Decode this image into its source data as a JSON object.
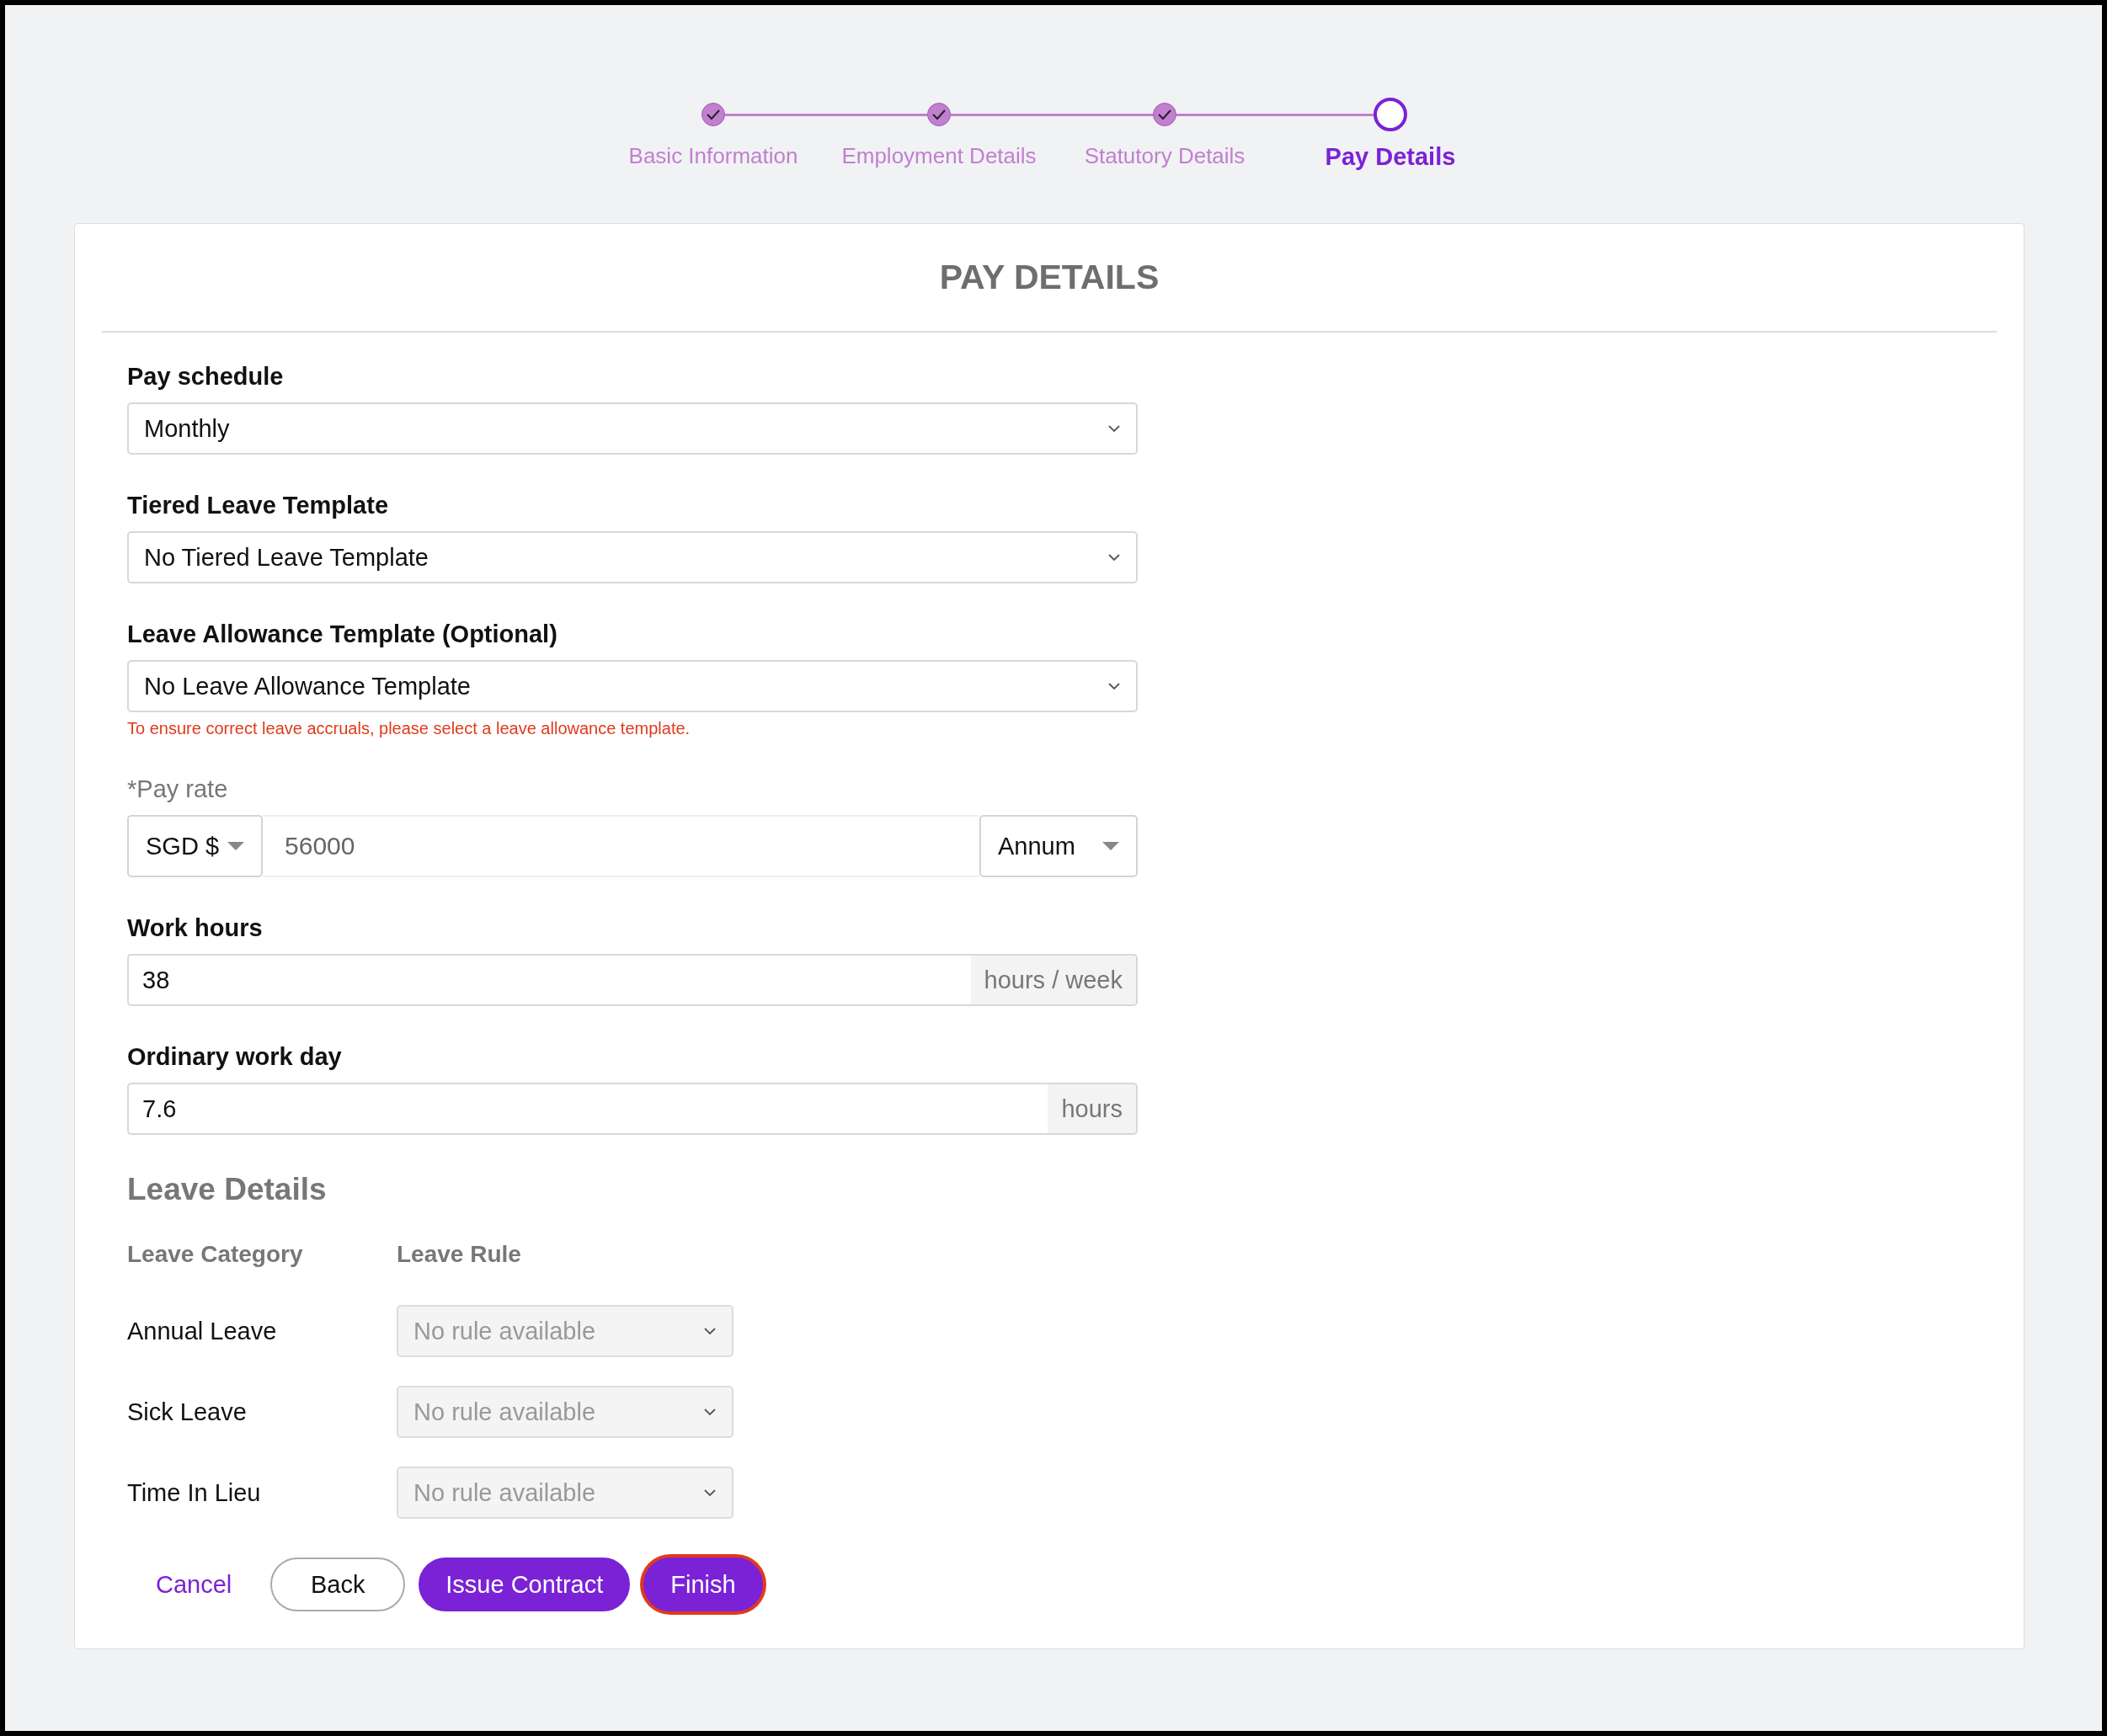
{
  "steps": [
    {
      "label": "Basic Information",
      "done": true,
      "selected": false
    },
    {
      "label": "Employment Details",
      "done": true,
      "selected": false
    },
    {
      "label": "Statutory Details",
      "done": true,
      "selected": false
    },
    {
      "label": "Pay Details",
      "done": false,
      "selected": true
    }
  ],
  "title": "PAY DETAILS",
  "selects": [
    {
      "label": "Pay schedule",
      "value": "Monthly"
    },
    {
      "label": "Tiered Leave Template",
      "value": "No Tiered Leave Template"
    },
    {
      "label": "Leave Allowance Template (Optional)",
      "value": "No Leave Allowance Template",
      "error": "To ensure correct leave accruals, please select a leave allowance template."
    }
  ],
  "pay_rate": {
    "label": "*Pay rate",
    "currency": "SGD $",
    "value": "56000",
    "period": "Annum"
  },
  "addon_fields": [
    {
      "label": "Work hours",
      "value": "38",
      "unit": "hours / week"
    },
    {
      "label": "Ordinary work day",
      "value": "7.6",
      "unit": "hours"
    }
  ],
  "leave_details": {
    "heading": "Leave Details",
    "columns": [
      "Leave Category",
      "Leave Rule"
    ],
    "rows": [
      {
        "category": "Annual Leave",
        "rule": "No rule available",
        "disabled": true
      },
      {
        "category": "Sick Leave",
        "rule": "No rule available",
        "disabled": true
      },
      {
        "category": "Time In Lieu",
        "rule": "No rule available",
        "disabled": true
      }
    ]
  },
  "buttons": [
    {
      "label": "Cancel",
      "kind": "link",
      "focused": false
    },
    {
      "label": "Back",
      "kind": "outline",
      "focused": false
    },
    {
      "label": "Issue Contract",
      "kind": "primary",
      "focused": false
    },
    {
      "label": "Finish",
      "kind": "primary",
      "focused": true
    }
  ]
}
